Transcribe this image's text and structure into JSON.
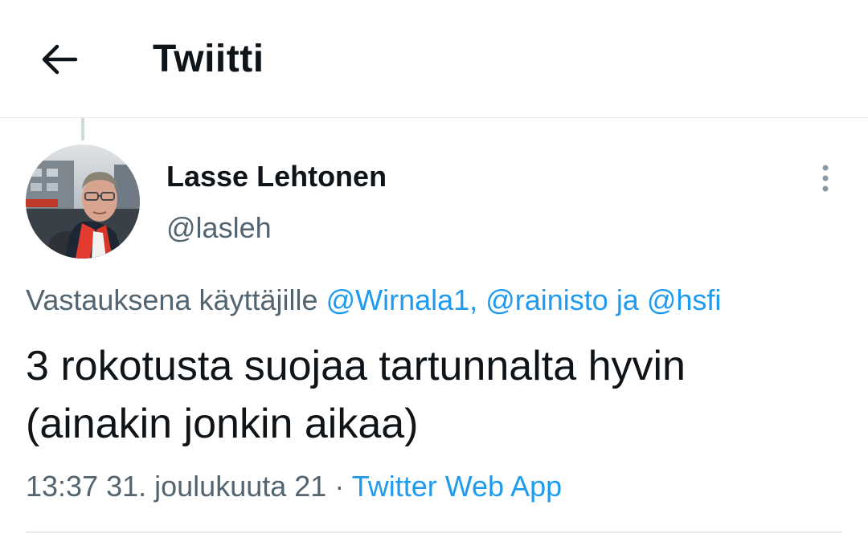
{
  "header": {
    "back_icon": "arrow-left-icon",
    "title": "Twiitti"
  },
  "tweet": {
    "author": {
      "name": "Lasse Lehtonen",
      "handle": "@lasleh",
      "avatar": "avatar-photo"
    },
    "more_icon": "more-vertical-icon",
    "reply": {
      "prefix": "Vastauksena käyttäjille",
      "mention_1": "@Wirnala1,",
      "mention_2": "@rainisto",
      "connector": "ja",
      "mention_3": "@hsfi"
    },
    "text_line_1": "3 rokotusta suojaa tartunnalta hyvin",
    "text_line_2": "(ainakin jonkin aikaa)",
    "timestamp": "13:37 31. joulukuuta 21",
    "separator": "·",
    "source": "Twitter Web App"
  },
  "colors": {
    "accent": "#1d9bf0",
    "secondary_text": "#536471",
    "primary_text": "#0f1419",
    "divider": "#e6e9ec"
  }
}
